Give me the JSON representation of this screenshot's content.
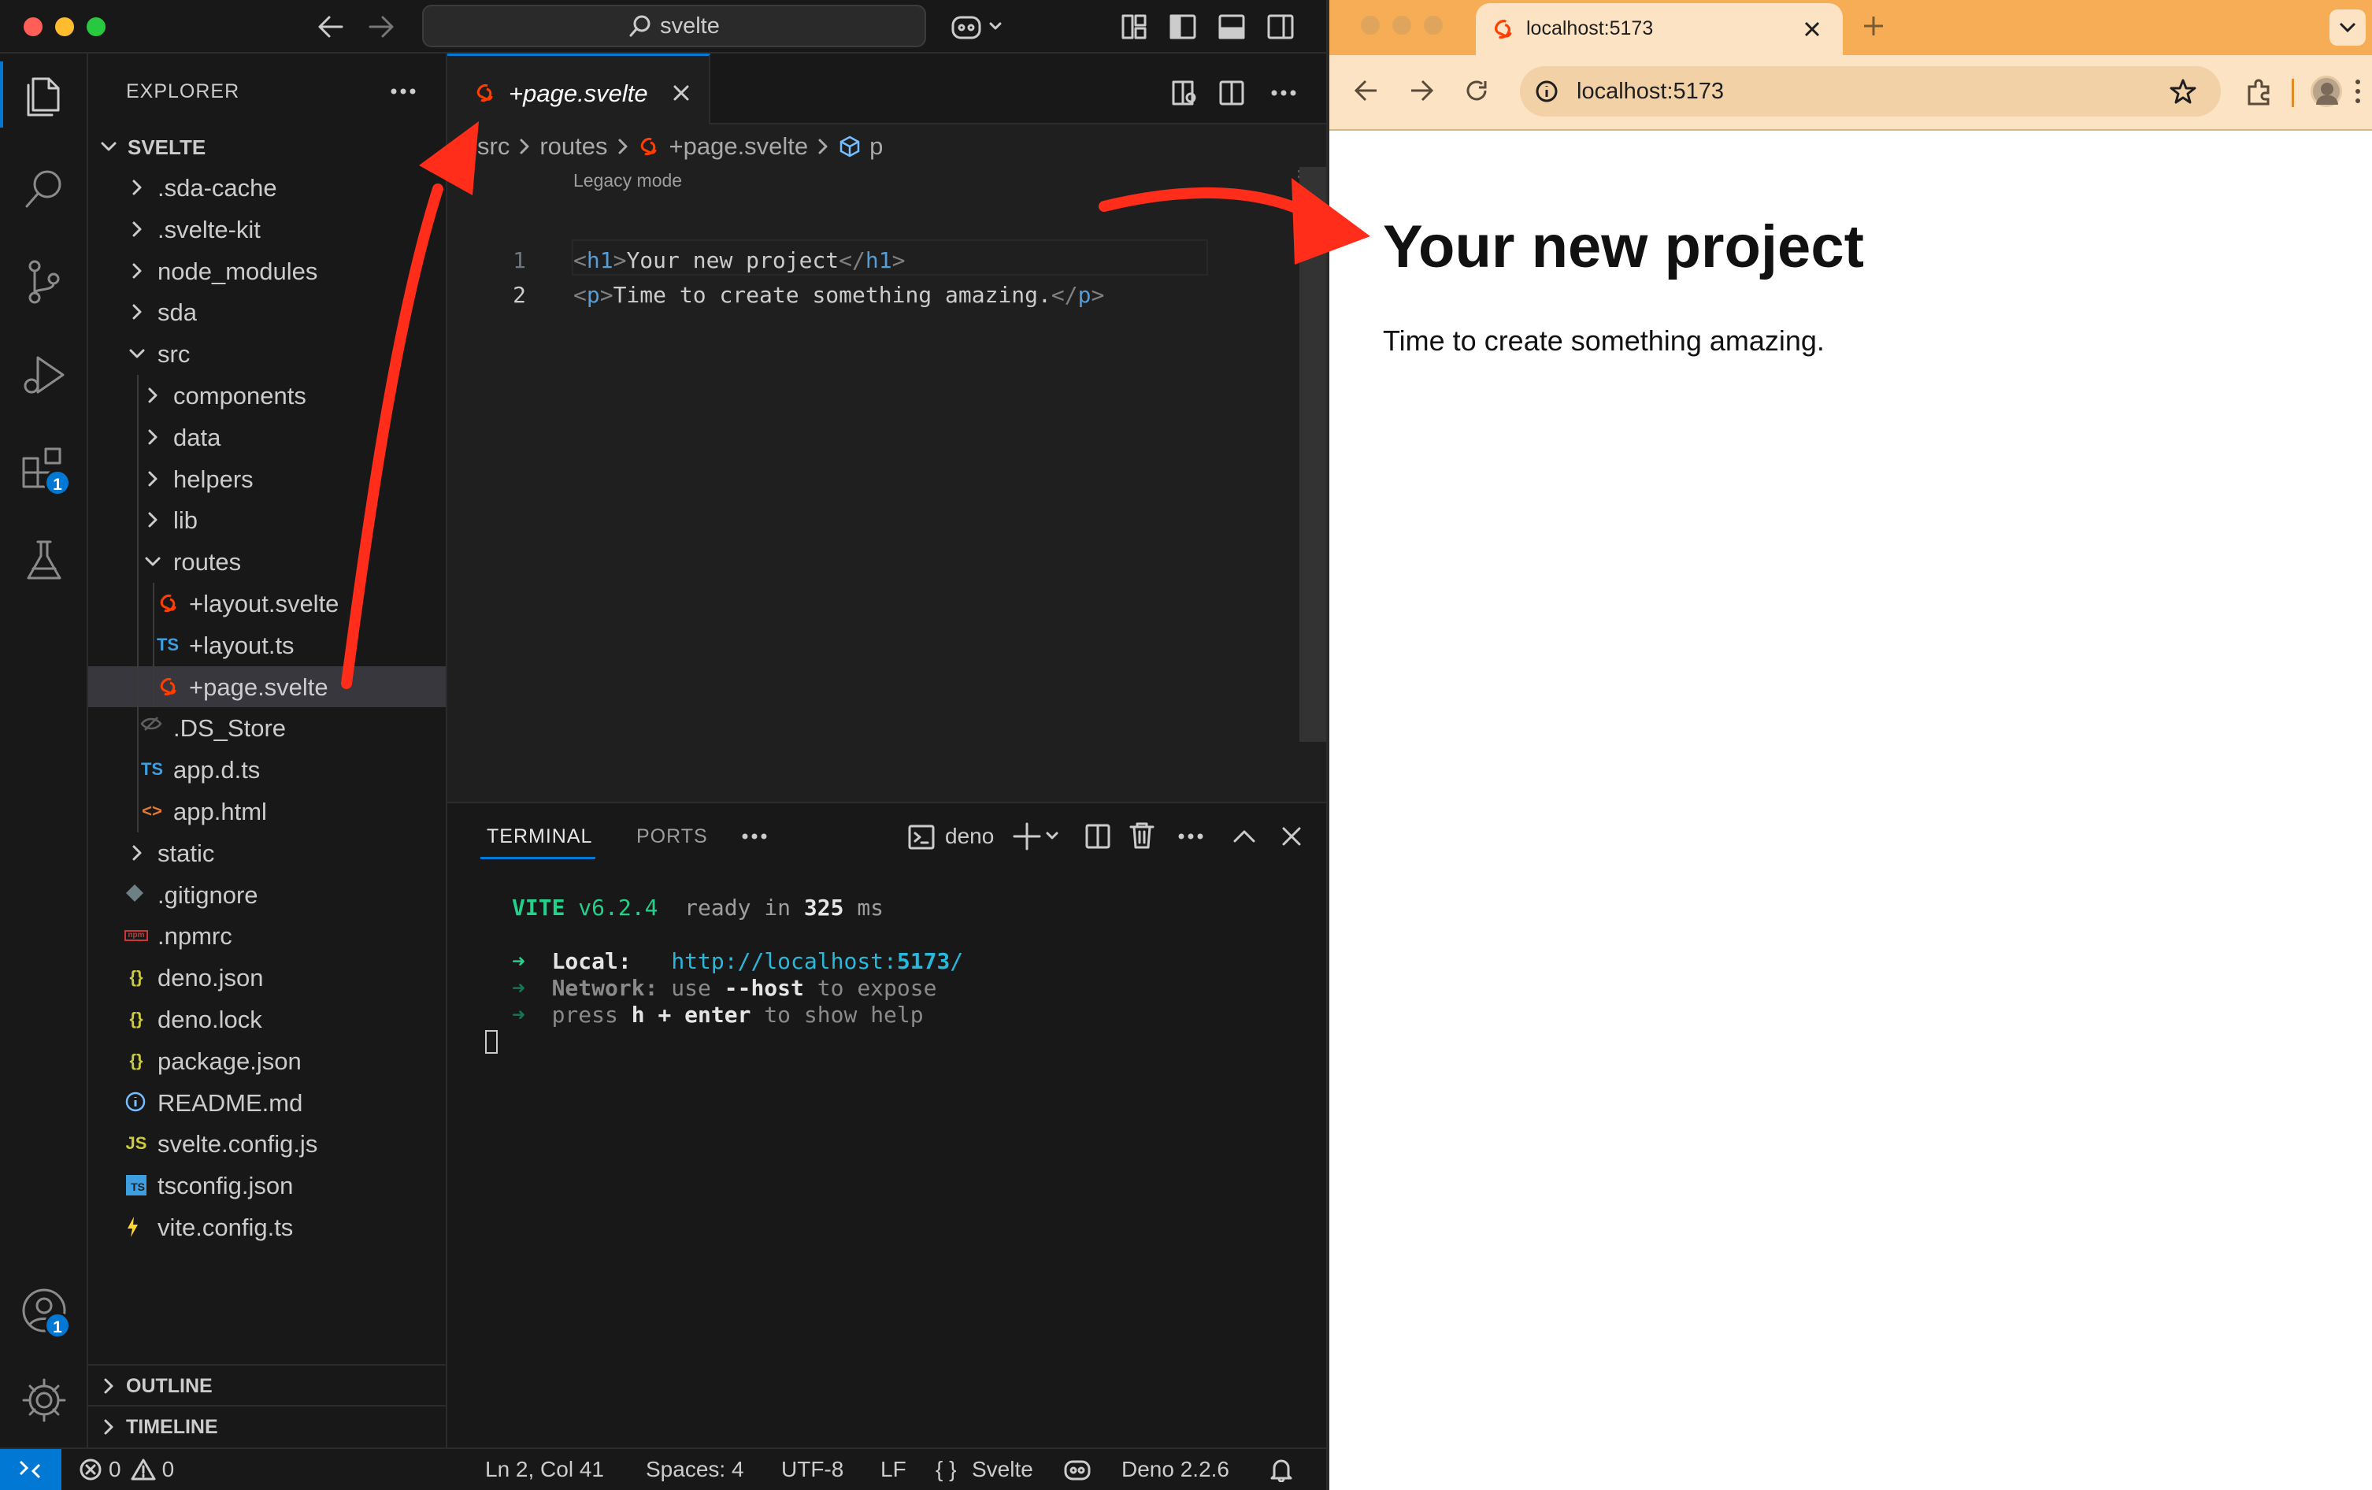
{
  "vscode": {
    "search_text": "svelte",
    "explorer_title": "EXPLORER",
    "workspace": "SVELTE",
    "tree": [
      {
        "label": ".sda-cache",
        "depth": 0,
        "type": "folder",
        "open": false
      },
      {
        "label": ".svelte-kit",
        "depth": 0,
        "type": "folder",
        "open": false
      },
      {
        "label": "node_modules",
        "depth": 0,
        "type": "folder",
        "open": false
      },
      {
        "label": "sda",
        "depth": 0,
        "type": "folder",
        "open": false
      },
      {
        "label": "src",
        "depth": 0,
        "type": "folder",
        "open": true
      },
      {
        "label": "components",
        "depth": 1,
        "type": "folder",
        "open": false
      },
      {
        "label": "data",
        "depth": 1,
        "type": "folder",
        "open": false
      },
      {
        "label": "helpers",
        "depth": 1,
        "type": "folder",
        "open": false
      },
      {
        "label": "lib",
        "depth": 1,
        "type": "folder",
        "open": false
      },
      {
        "label": "routes",
        "depth": 1,
        "type": "folder",
        "open": true
      },
      {
        "label": "+layout.svelte",
        "depth": 2,
        "type": "file",
        "icon": "svelte"
      },
      {
        "label": "+layout.ts",
        "depth": 2,
        "type": "file",
        "icon": "ts",
        "glyph": "TS"
      },
      {
        "label": "+page.svelte",
        "depth": 2,
        "type": "file",
        "icon": "svelte",
        "selected": true
      },
      {
        "label": ".DS_Store",
        "depth": 1,
        "type": "file",
        "icon": "hidden"
      },
      {
        "label": "app.d.ts",
        "depth": 1,
        "type": "file",
        "icon": "ts",
        "glyph": "TS"
      },
      {
        "label": "app.html",
        "depth": 1,
        "type": "file",
        "icon": "html",
        "glyph": "<>"
      },
      {
        "label": "static",
        "depth": 0,
        "type": "folder",
        "open": false
      },
      {
        "label": ".gitignore",
        "depth": 0,
        "type": "file",
        "icon": "git"
      },
      {
        "label": ".npmrc",
        "depth": 0,
        "type": "file",
        "icon": "npm",
        "glyph": "npm"
      },
      {
        "label": "deno.json",
        "depth": 0,
        "type": "file",
        "icon": "json",
        "glyph": "{}"
      },
      {
        "label": "deno.lock",
        "depth": 0,
        "type": "file",
        "icon": "json",
        "glyph": "{}"
      },
      {
        "label": "package.json",
        "depth": 0,
        "type": "file",
        "icon": "json",
        "glyph": "{}"
      },
      {
        "label": "README.md",
        "depth": 0,
        "type": "file",
        "icon": "info"
      },
      {
        "label": "svelte.config.js",
        "depth": 0,
        "type": "file",
        "icon": "js",
        "glyph": "JS"
      },
      {
        "label": "tsconfig.json",
        "depth": 0,
        "type": "file",
        "icon": "tsconfig",
        "glyph": "TS"
      },
      {
        "label": "vite.config.ts",
        "depth": 0,
        "type": "file",
        "icon": "vite"
      }
    ],
    "outline": "OUTLINE",
    "timeline": "TIMELINE",
    "tab_label": "+page.svelte",
    "breadcrumbs": [
      "src",
      "routes",
      "+page.svelte",
      "p"
    ],
    "legacy_mode": "Legacy mode",
    "code_lines": [
      {
        "num": "1",
        "parts": [
          {
            "t": "<",
            "c": "#808080"
          },
          {
            "t": "h1",
            "c": "#569cd6"
          },
          {
            "t": ">",
            "c": "#808080"
          },
          {
            "t": "Your new project",
            "c": "#cccccc"
          },
          {
            "t": "</",
            "c": "#808080"
          },
          {
            "t": "h1",
            "c": "#569cd6"
          },
          {
            "t": ">",
            "c": "#808080"
          }
        ]
      },
      {
        "num": "2",
        "parts": [
          {
            "t": "<",
            "c": "#808080"
          },
          {
            "t": "p",
            "c": "#569cd6"
          },
          {
            "t": ">",
            "c": "#808080"
          },
          {
            "t": "Time to create something amazing.",
            "c": "#cccccc"
          },
          {
            "t": "</",
            "c": "#808080"
          },
          {
            "t": "p",
            "c": "#569cd6"
          },
          {
            "t": ">",
            "c": "#808080"
          }
        ]
      }
    ],
    "panel_tabs": [
      "TERMINAL",
      "PORTS"
    ],
    "terminal_name": "deno",
    "terminal": {
      "vite": "VITE",
      "version": "v6.2.4",
      "ready": "ready in",
      "ms_value": "325",
      "ms_unit": "ms",
      "arrow": "➜",
      "local_label": "Local:",
      "local_url_prefix": "http://localhost:",
      "local_url_port": "5173",
      "local_url_suffix": "/",
      "network_label": "Network:",
      "network_use": "use",
      "network_host": "--host",
      "network_rest": "to expose",
      "press": "press",
      "press_h": "h",
      "press_plus": "+",
      "press_enter": "enter",
      "press_rest": "to show help"
    },
    "status": {
      "errors": "0",
      "warnings": "0",
      "position": "Ln 2, Col 41",
      "spaces": "Spaces: 4",
      "encoding": "UTF-8",
      "eol": "LF",
      "language_prefix": "{ }",
      "language": "Svelte",
      "runtime": "Deno 2.2.6"
    },
    "badges": {
      "extensions": "1",
      "accounts": "1"
    }
  },
  "browser": {
    "tab_title": "localhost:5173",
    "address": "localhost:5173",
    "heading": "Your new project",
    "paragraph": "Time to create something amazing."
  },
  "colors": {
    "accent": "#0078d4",
    "arrow": "#ff2d1a",
    "browser_chrome": "#f6ad55",
    "svelte": "#ff3e00"
  }
}
